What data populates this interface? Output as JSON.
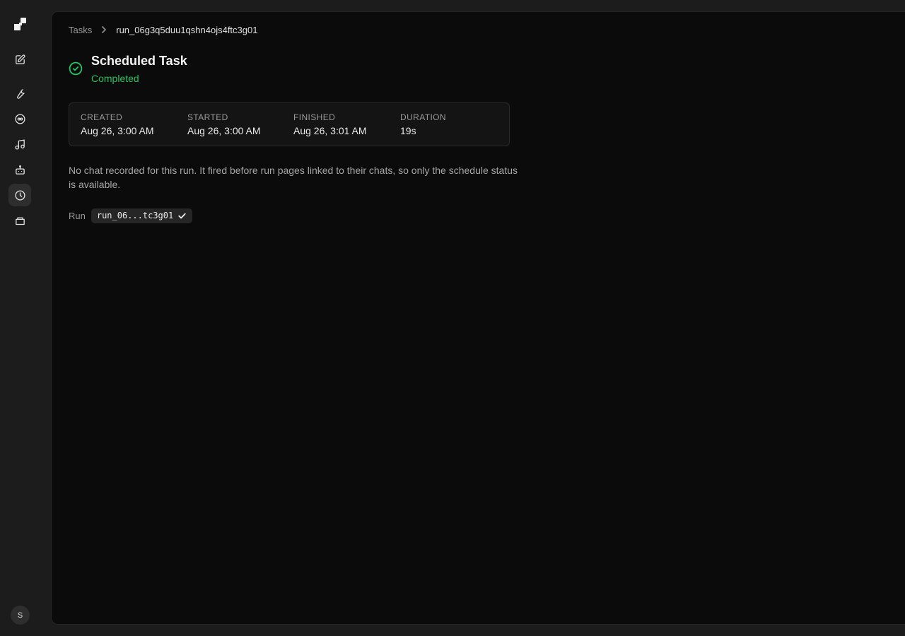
{
  "rail": {
    "icons": [
      "logo-icon",
      "new-chat-icon",
      "tools-icon",
      "models-icon",
      "music-icon",
      "bot-icon",
      "clock-icon",
      "folder-icon"
    ],
    "active": "clock-icon",
    "avatar_initial": "S"
  },
  "breadcrumb": {
    "root": "Tasks",
    "current": "run_06g3q5duu1qshn4ojs4ftc3g01"
  },
  "task": {
    "title": "Scheduled Task",
    "status": "Completed",
    "status_color": "#22c55e"
  },
  "meta": [
    {
      "label": "CREATED",
      "value": "Aug 26, 3:00 AM"
    },
    {
      "label": "STARTED",
      "value": "Aug 26, 3:00 AM"
    },
    {
      "label": "FINISHED",
      "value": "Aug 26, 3:01 AM"
    },
    {
      "label": "DURATION",
      "value": "19s"
    }
  ],
  "note": "No chat recorded for this run. It fired before run pages linked to their chats, so only the schedule status is available.",
  "run": {
    "label": "Run",
    "id_short": "run_06...tc3g01"
  }
}
